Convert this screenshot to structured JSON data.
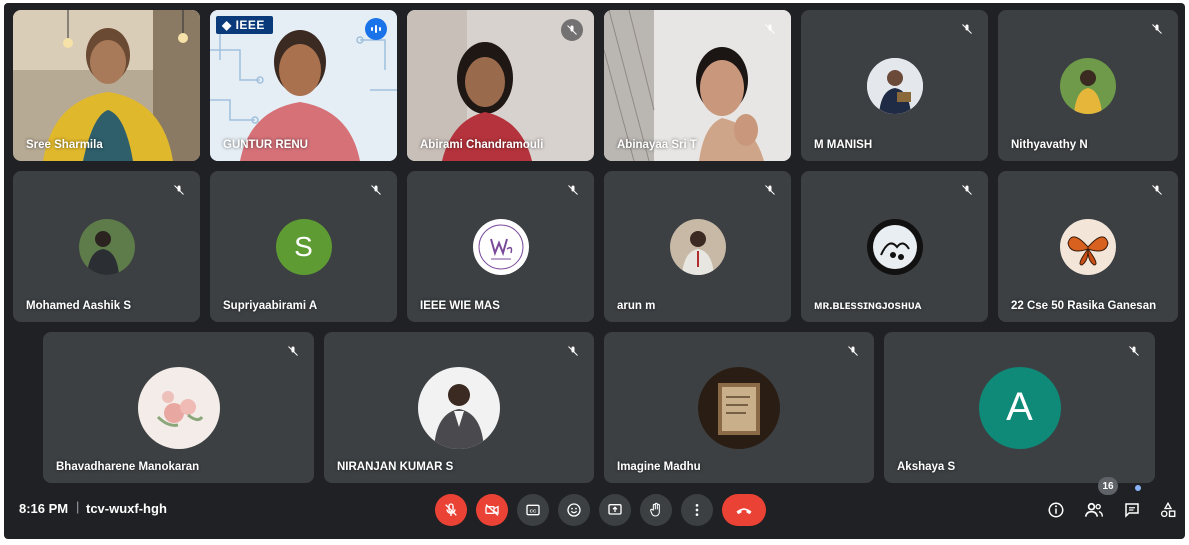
{
  "participants": [
    {
      "name": "Sree Sharmila",
      "muted": false
    },
    {
      "name": "GUNTUR RENU",
      "speaking": true,
      "badge": "IEEE"
    },
    {
      "name": "Abirami Chandramouli",
      "muted": true
    },
    {
      "name": "Abinayaa Sri T",
      "muted": true
    },
    {
      "name": "M MANISH",
      "muted": true
    },
    {
      "name": "Nithyavathy N",
      "muted": true
    },
    {
      "name": "Mohamed Aashik S",
      "muted": true
    },
    {
      "name": "Supriyaabirami A",
      "muted": true,
      "initial": "S",
      "avatar_color": "#5e9c33"
    },
    {
      "name": "IEEE WIE MAS",
      "muted": true
    },
    {
      "name": "arun m",
      "muted": true
    },
    {
      "name": "ᴍʀ.ʙʟᴇssɪɴɢᴊᴏsʜᴜᴀ",
      "muted": true
    },
    {
      "name": "22 Cse 50 Rasika Ganesan",
      "muted": true
    },
    {
      "name": "Bhavadharene Manokaran",
      "muted": true
    },
    {
      "name": "NIRANJAN KUMAR S",
      "muted": true
    },
    {
      "name": "Imagine Madhu",
      "muted": true
    },
    {
      "name": "Akshaya S",
      "muted": true,
      "initial": "A",
      "avatar_color": "#0f8a78"
    }
  ],
  "bottom_bar": {
    "time": "8:16 PM",
    "separator": "|",
    "meeting_code": "tcv-wuxf-hgh",
    "controls": [
      {
        "name": "mic-off",
        "state": "off"
      },
      {
        "name": "camera-off",
        "state": "off"
      },
      {
        "name": "captions",
        "icon": "CC"
      },
      {
        "name": "emoji-reactions"
      },
      {
        "name": "present-screen"
      },
      {
        "name": "raise-hand"
      },
      {
        "name": "more-options"
      },
      {
        "name": "leave-call"
      }
    ],
    "right": {
      "info": "info-icon",
      "people_count": "16",
      "chat": "chat-icon",
      "activities": "activities-icon"
    }
  },
  "colors": {
    "background": "#202124",
    "tile": "#3c4043",
    "hangup": "#ea4335",
    "active_speaker": "#8ab4f8"
  }
}
